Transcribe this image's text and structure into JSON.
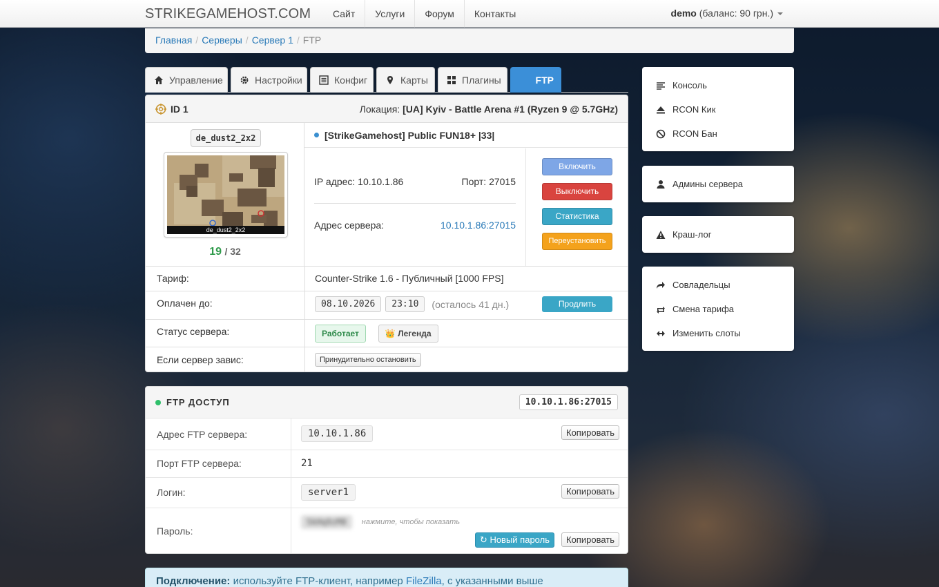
{
  "nav": {
    "brand": "STRIKEGAMEHOST.COM",
    "links": [
      "Сайт",
      "Услуги",
      "Форум",
      "Контакты"
    ],
    "user": "demo",
    "balance": "(баланс: 90 грн.)"
  },
  "breadcrumb": {
    "items": [
      "Главная",
      "Серверы",
      "Сервер 1"
    ],
    "current": "FTP"
  },
  "tabs": [
    "Управление",
    "Настройки",
    "Конфиг",
    "Карты",
    "Плагины",
    "FTP"
  ],
  "server": {
    "id": "ID 1",
    "location_label": "Локация:",
    "location": "[UA] Kyiv - Battle Arena #1 (Ryzen 9 @ 5.7GHz)",
    "map": "de_dust2_2x2",
    "map_caption": "de_dust2_2x2",
    "players_on": "19",
    "players_max": "/ 32",
    "name": "[StrikeGamehost] Public FUN18+ |33|",
    "ip_label": "IP адрес: 10.10.1.86",
    "port_label": "Порт: 27015",
    "addr_label": "Адрес сервера:",
    "addr": "10.10.1.86:27015",
    "buttons": {
      "on": "Включить",
      "off": "Выключить",
      "stats": "Статистика",
      "reinstall": "Переустановить"
    },
    "rows": {
      "tariff_label": "Тариф:",
      "tariff": "Counter-Strike 1.6 - Публичный [1000 FPS]",
      "paid_label": "Оплачен до:",
      "paid_date": "08.10.2026",
      "paid_time": "23:10",
      "remaining": "(осталось 41 дн.)",
      "extend": "Продлить",
      "status_label": "Статус сервера:",
      "status": "Работает",
      "rank": "👑 Легенда",
      "hang_label": "Если сервер завис:",
      "force_stop": "Принудительно остановить"
    }
  },
  "ftp": {
    "title": "FTP ДОСТУП",
    "badge": "10.10.1.86:27015",
    "addr_label": "Адрес FTP сервера:",
    "addr": "10.10.1.86",
    "port_label": "Порт FTP сервера:",
    "port": "21",
    "login_label": "Логин:",
    "login": "server1",
    "pass_label": "Пароль:",
    "pass_masked": "5kHq9zM8",
    "pass_hint": "нажмите, чтобы показать",
    "copy": "Копировать",
    "new_pass": "↻ Новый пароль"
  },
  "alert": {
    "bold": "Подключение:",
    "text": " используйте FTP-клиент, например ",
    "link": "FileZilla",
    "text2": ", с указанными выше"
  },
  "sidebar": {
    "group1": [
      "Консоль",
      "RCON Кик",
      "RCON Бан"
    ],
    "group2": [
      "Админы сервера"
    ],
    "group3": [
      "Краш-лог"
    ],
    "group4": [
      "Совладельцы",
      "Смена тарифа",
      "Изменить слоты"
    ]
  }
}
